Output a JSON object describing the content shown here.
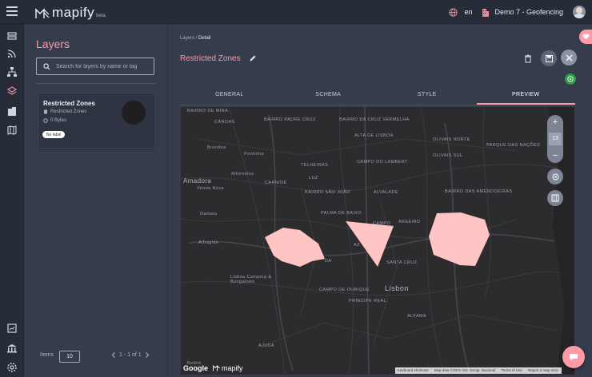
{
  "app": {
    "logo_text": "mapify",
    "logo_badge": "beta"
  },
  "topbar": {
    "language": "en",
    "organization": "Demo 7 - Geofencing"
  },
  "nav": {
    "items": [
      "menu-icon",
      "dashboard-icon",
      "rss-icon",
      "hierarchy-icon",
      "layers-icon",
      "buildings-icon",
      "map-book-icon",
      "report-icon",
      "bank-icon",
      "settings-icon"
    ]
  },
  "layers_panel": {
    "title": "Layers",
    "search_placeholder": "Search for layers by name or tag",
    "card": {
      "title": "Restricted Zones",
      "subtitle": "Restricted Zones",
      "size": "0 Bytes",
      "tag": "No label"
    },
    "items_label": "Items",
    "items_per_page": "10",
    "page_range": "1 - 1 of 1"
  },
  "main": {
    "breadcrumb_root": "Layers",
    "breadcrumb_sep": "/",
    "breadcrumb_current": "Detail",
    "title": "Restricted Zones",
    "tabs": [
      {
        "label": "GENERAL"
      },
      {
        "label": "SCHEMA"
      },
      {
        "label": "STYLE"
      },
      {
        "label": "PREVIEW",
        "active": true
      }
    ]
  },
  "map": {
    "zoom_level": "13",
    "zoom_in": "+",
    "zoom_out": "−",
    "polygon_color": "#ffc4c4",
    "labels": [
      "BAIRRO DE MIRA",
      "CANOAS",
      "BAIRRO PADRE CRUZ",
      "BAIRRO DA CRUZ VERMELHA",
      "ALTA DE LISBOA",
      "OLIVAIS NORTE",
      "PARQUE DAS NAÇÕES",
      "OLIVAIS SUL",
      "Brandoa",
      "Pontinha",
      "Alfornelos",
      "TELHEIRAS",
      "CAMPO DO LAMBERT",
      "CARNIDE",
      "LUZ",
      "Amadora",
      "Venda Nova",
      "BAIRRO SÃO JOÃO",
      "ALVALADE",
      "BAIRRO DAS AMENDOEIRAS",
      "Damaia",
      "PALMA DE BAIXO",
      "CAMPO",
      "AREEIRO",
      "Alfragide",
      "AZ",
      "DA",
      "SANTA CRUZ",
      "Lisboa Camping & Bungalows",
      "CAMPO DE OURIQUE",
      "Lisbon",
      "PRÍNCIPE REAL",
      "ALFAMA",
      "AJUDA",
      "Belém"
    ],
    "attribution": [
      "Keyboard shortcuts",
      "Map data ©2021 Inst. Geogr. Nacional",
      "Terms of Use",
      "Report a map error"
    ],
    "google_text": "Google",
    "mapify_text": "mapify"
  },
  "colors": {
    "accent": "#ff9aa6",
    "bg": "#353d4c",
    "topbar": "#262c38",
    "success": "#2e9b45"
  }
}
